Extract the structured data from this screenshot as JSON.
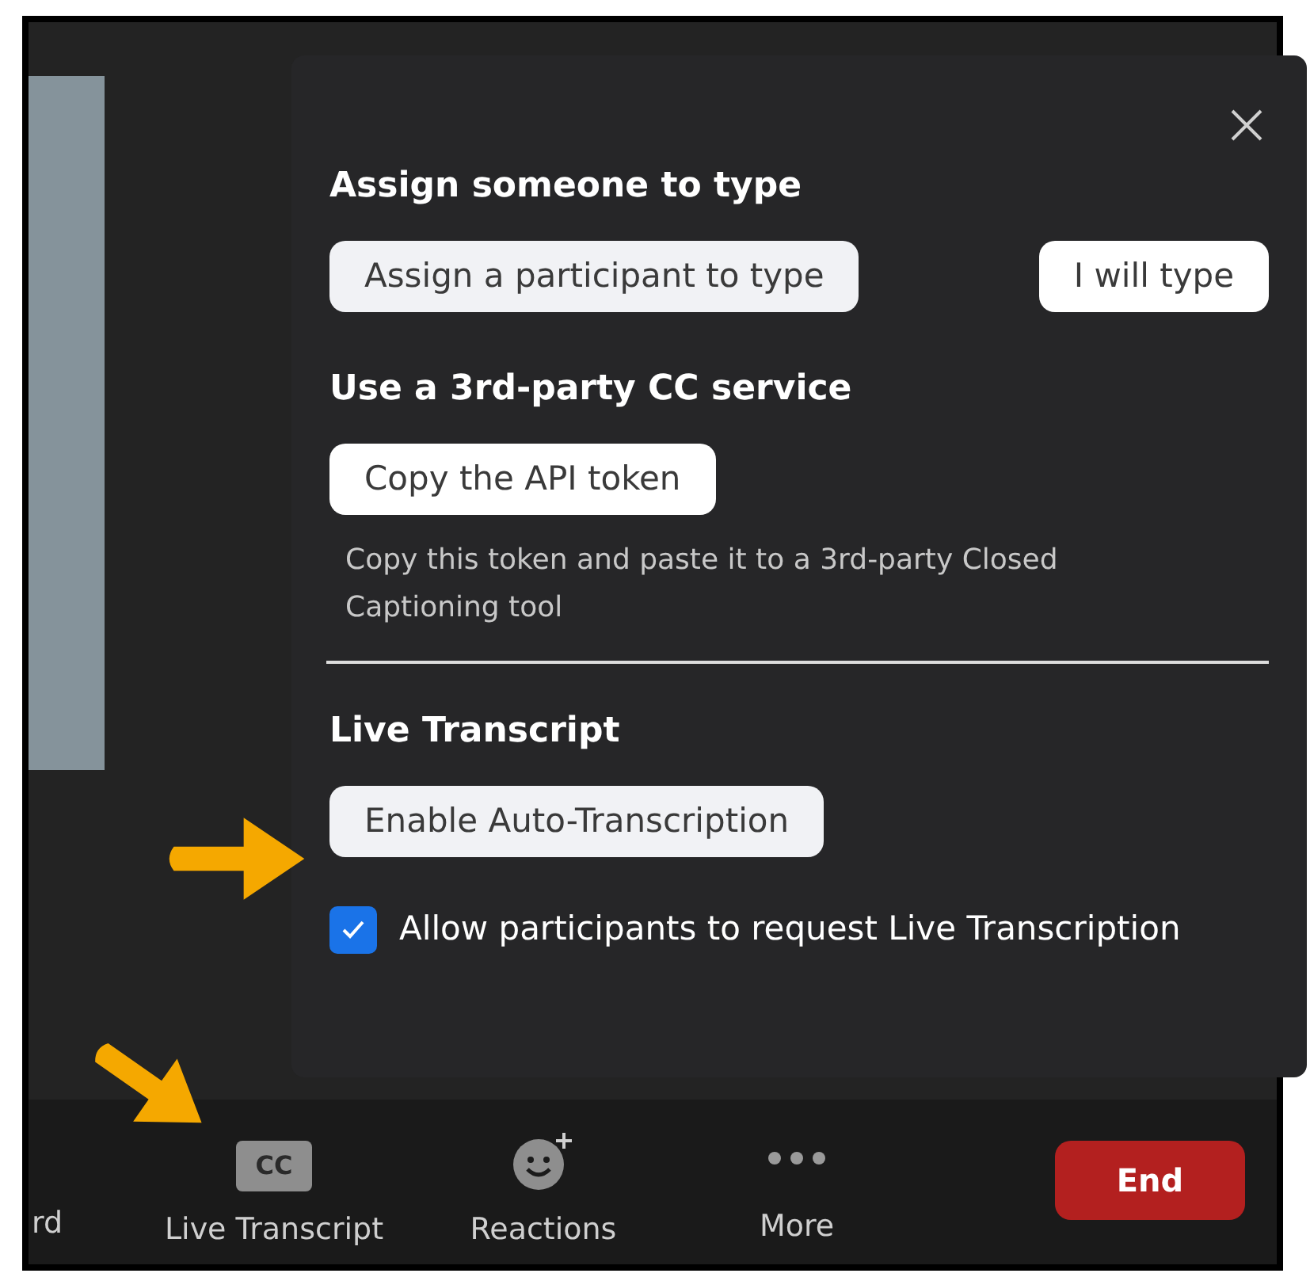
{
  "panel": {
    "sections": [
      {
        "heading": "Assign someone to type",
        "buttons": [
          {
            "label": "Assign a participant to type",
            "selected": true
          },
          {
            "label": "I will type",
            "selected": false
          }
        ]
      },
      {
        "heading": "Use a 3rd-party CC service",
        "buttons": [
          {
            "label": "Copy the API token",
            "selected": false
          }
        ],
        "description": "Copy this token and paste it to a 3rd-party Closed Captioning tool"
      },
      {
        "heading": "Live Transcript",
        "buttons": [
          {
            "label": "Enable Auto-Transcription",
            "selected": true
          }
        ],
        "checkbox": {
          "label": "Allow participants to request Live Transcription",
          "checked": true
        }
      }
    ]
  },
  "toolbar": {
    "items": [
      {
        "kind": "text",
        "label": "rd"
      },
      {
        "kind": "cc",
        "badge": "CC",
        "label": "Live Transcript"
      },
      {
        "kind": "reactions",
        "label": "Reactions"
      },
      {
        "kind": "more",
        "label": "More"
      }
    ],
    "end_button": "End"
  }
}
